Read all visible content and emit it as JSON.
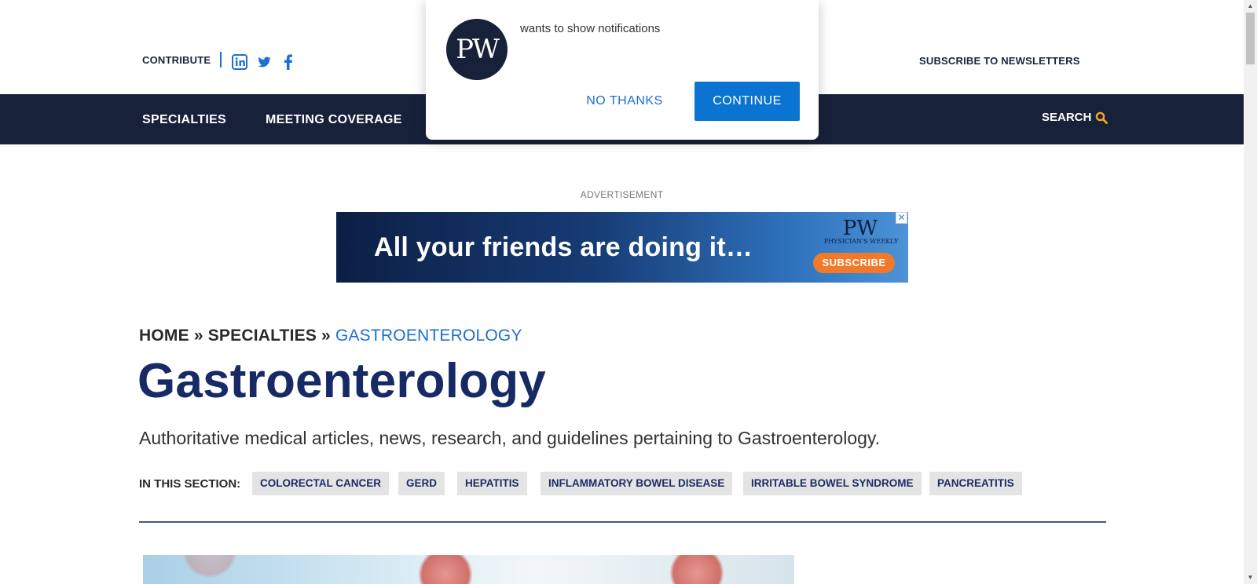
{
  "header": {
    "contribute_label": "CONTRIBUTE",
    "subscribe_newsletters_label": "SUBSCRIBE TO NEWSLETTERS",
    "social_icons": [
      "linkedin-icon",
      "twitter-icon",
      "facebook-icon"
    ],
    "social_color": "#1c6fd1"
  },
  "nav": {
    "items": [
      "SPECIALTIES",
      "MEETING COVERAGE"
    ],
    "search_label": "SEARCH",
    "search_icon_color": "#f5a623",
    "background": "#18213a"
  },
  "ad": {
    "label": "ADVERTISEMENT",
    "headline": "All your friends are doing it…",
    "logo_text": "PW",
    "logo_sub": "PHYSICIAN'S WEEKLY",
    "cta": "SUBSCRIBE",
    "close_glyph": "✕"
  },
  "breadcrumb": {
    "home": "HOME",
    "sep": "»",
    "specialties": "SPECIALTIES",
    "current": "GASTROENTEROLOGY"
  },
  "page": {
    "title": "Gastroenterology",
    "description": "Authoritative medical articles, news, research, and guidelines pertaining to Gastroenterology.",
    "section_label": "IN THIS SECTION:",
    "section_links": [
      "COLORECTAL CANCER",
      "GERD",
      "HEPATITIS",
      "INFLAMMATORY BOWEL DISEASE",
      "IRRITABLE BOWEL SYNDROME",
      "PANCREATITIS"
    ]
  },
  "notification": {
    "logo_text": "PW",
    "message": "wants to show notifications",
    "no_label": "NO THANKS",
    "yes_label": "CONTINUE",
    "accent": "#0b74d1"
  }
}
